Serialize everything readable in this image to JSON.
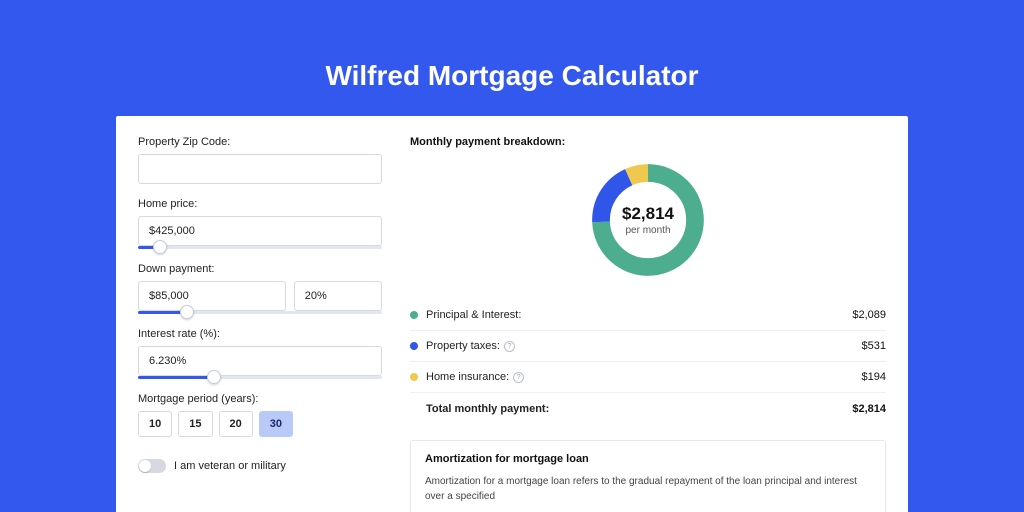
{
  "title": "Wilfred Mortgage Calculator",
  "form": {
    "zip_label": "Property Zip Code:",
    "zip_value": "",
    "home_price_label": "Home price:",
    "home_price_value": "$425,000",
    "home_price_slider_pct": 9,
    "down_payment_label": "Down payment:",
    "down_payment_value": "$85,000",
    "down_payment_pct_value": "20%",
    "down_payment_slider_pct": 20,
    "interest_label": "Interest rate (%):",
    "interest_value": "6.230%",
    "interest_slider_pct": 31,
    "period_label": "Mortgage period (years):",
    "periods": [
      "10",
      "15",
      "20",
      "30"
    ],
    "period_selected_index": 3,
    "veteran_label": "I am veteran or military"
  },
  "breakdown": {
    "title": "Monthly payment breakdown:",
    "center_amount": "$2,814",
    "center_sub": "per month",
    "items": [
      {
        "label": "Principal & Interest:",
        "value": "$2,089",
        "color": "#4cae8f",
        "help": false
      },
      {
        "label": "Property taxes:",
        "value": "$531",
        "color": "#2f56e8",
        "help": true
      },
      {
        "label": "Home insurance:",
        "value": "$194",
        "color": "#efc84e",
        "help": true
      }
    ],
    "total_label": "Total monthly payment:",
    "total_value": "$2,814"
  },
  "chart_data": {
    "type": "pie",
    "title": "Monthly payment breakdown",
    "series": [
      {
        "name": "Principal & Interest",
        "value": 2089,
        "color": "#4cae8f"
      },
      {
        "name": "Property taxes",
        "value": 531,
        "color": "#2f56e8"
      },
      {
        "name": "Home insurance",
        "value": 194,
        "color": "#efc84e"
      }
    ],
    "total": 2814,
    "unit": "$ per month"
  },
  "amortization": {
    "title": "Amortization for mortgage loan",
    "body": "Amortization for a mortgage loan refers to the gradual repayment of the loan principal and interest over a specified"
  }
}
